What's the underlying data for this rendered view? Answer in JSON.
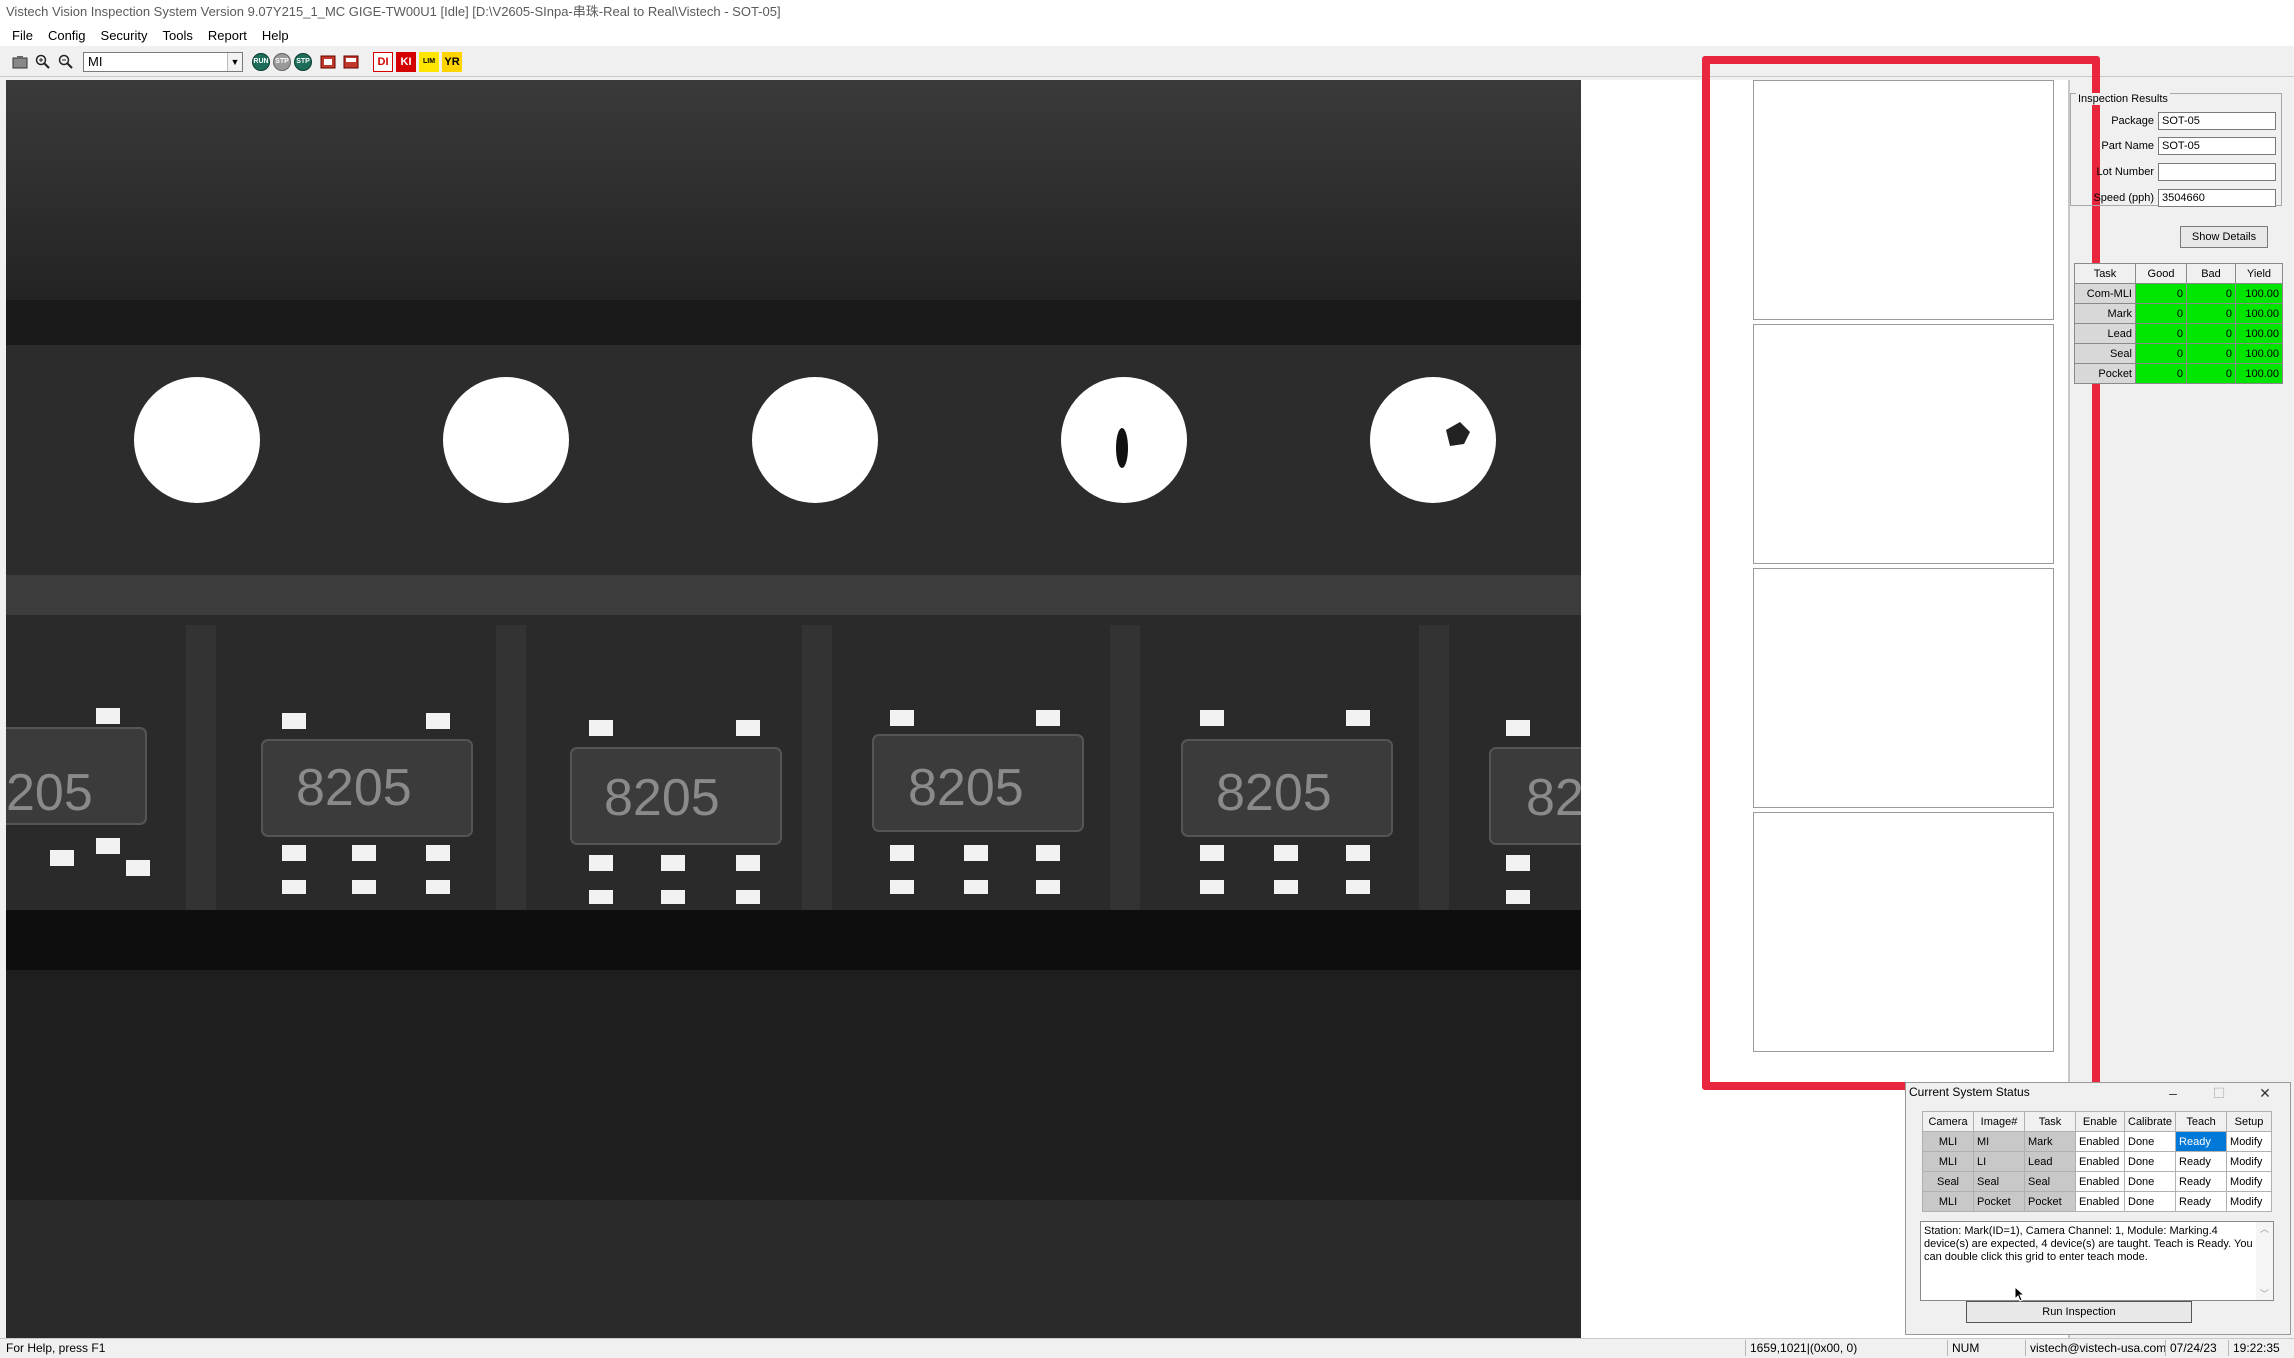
{
  "window": {
    "title": "Vistech Vision Inspection System Version 9.07Y215_1_MC GIGE-TW00U1 [Idle] [D:\\V2605-SInpa-串珠-Real to Real\\Vistech - SOT-05]"
  },
  "menu": [
    "File",
    "Config",
    "Security",
    "Tools",
    "Report",
    "Help"
  ],
  "toolbar": {
    "image_select": "MI",
    "box_labels": [
      "DI",
      "KI",
      "LIM",
      "YR"
    ]
  },
  "camera_view": {
    "chip_labels": [
      "205",
      "8205",
      "8205",
      "8205",
      "8205",
      "82"
    ]
  },
  "inspection_results": {
    "group_title": "Inspection Results",
    "fields": [
      {
        "label": "Package",
        "value": "SOT-05"
      },
      {
        "label": "Part Name",
        "value": "SOT-05"
      },
      {
        "label": "Lot Number",
        "value": ""
      },
      {
        "label": "Speed (pph)",
        "value": "3504660"
      }
    ],
    "show_details": "Show Details"
  },
  "yield_table": {
    "headers": [
      "Task",
      "Good",
      "Bad",
      "Yield"
    ],
    "rows": [
      {
        "task": "Com-MLI",
        "good": "0",
        "bad": "0",
        "yield": "100.00"
      },
      {
        "task": "Mark",
        "good": "0",
        "bad": "0",
        "yield": "100.00"
      },
      {
        "task": "Lead",
        "good": "0",
        "bad": "0",
        "yield": "100.00"
      },
      {
        "task": "Seal",
        "good": "0",
        "bad": "0",
        "yield": "100.00"
      },
      {
        "task": "Pocket",
        "good": "0",
        "bad": "0",
        "yield": "100.00"
      }
    ]
  },
  "status_window": {
    "title": "Current System Status",
    "headers": [
      "Camera",
      "Image#",
      "Task",
      "Enable",
      "Calibrate",
      "Teach",
      "Setup"
    ],
    "rows": [
      {
        "camera": "MLI",
        "image": "MI",
        "task": "Mark",
        "enable": "Enabled",
        "calibrate": "Done",
        "teach": "Ready",
        "setup": "Modify"
      },
      {
        "camera": "MLI",
        "image": "LI",
        "task": "Lead",
        "enable": "Enabled",
        "calibrate": "Done",
        "teach": "Ready",
        "setup": "Modify"
      },
      {
        "camera": "Seal",
        "image": "Seal",
        "task": "Seal",
        "enable": "Enabled",
        "calibrate": "Done",
        "teach": "Ready",
        "setup": "Modify"
      },
      {
        "camera": "MLI",
        "image": "Pocket",
        "task": "Pocket",
        "enable": "Enabled",
        "calibrate": "Done",
        "teach": "Ready",
        "setup": "Modify"
      }
    ],
    "message": "Station: Mark(ID=1), Camera Channel: 1, Module: Marking.4 device(s) are expected, 4 device(s) are taught. Teach is Ready. You can double click this grid to enter teach mode.",
    "run_button": "Run Inspection"
  },
  "statusbar": {
    "help": "For Help, press F1",
    "coords": "1659,1021|(0x00,  0)",
    "num": "NUM",
    "email": "vistech@vistech-usa.com",
    "date": "07/24/23",
    "time": "19:22:35"
  }
}
